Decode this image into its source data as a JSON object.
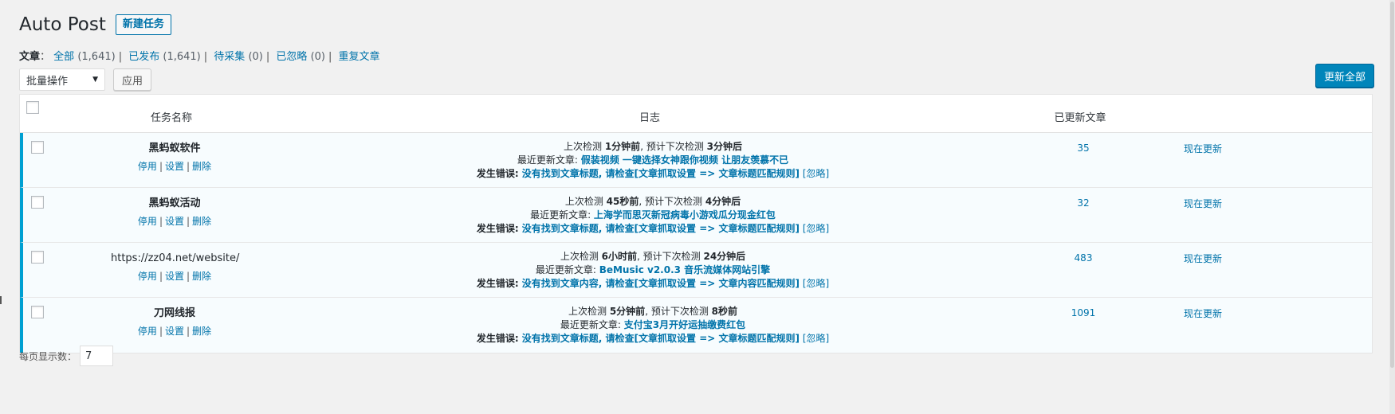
{
  "header": {
    "title": "Auto Post",
    "add_new": "新建任务"
  },
  "views": {
    "label": "文章",
    "colon": "：",
    "items": [
      {
        "label": "全部",
        "count": "(1,641)"
      },
      {
        "label": "已发布",
        "count": "(1,641)"
      },
      {
        "label": "待采集",
        "count": "(0)"
      },
      {
        "label": "已忽略",
        "count": "(0)"
      },
      {
        "label": "重复文章",
        "count": ""
      }
    ]
  },
  "tablenav": {
    "bulk_actions": "批量操作",
    "apply": "应用",
    "update_all": "更新全部"
  },
  "columns": {
    "name": "任务名称",
    "log": "日志",
    "updated": "已更新文章"
  },
  "row_actions": {
    "disable": "停用",
    "settings": "设置",
    "delete": "删除",
    "update_now": "现在更新"
  },
  "rows": [
    {
      "name": "黑蚂蚁软件",
      "last_check_prefix": "上次检测 ",
      "last_check": "1分钟前",
      "next_check_prefix": ", 预计下次检测 ",
      "next_check": "3分钟后",
      "latest_prefix": "最近更新文章: ",
      "latest": "假装视频 一键选择女神跟你视频 让朋友羡慕不已",
      "error_prefix": "发生错误:",
      "error": " 没有找到文章标题, 请检查[文章抓取设置 => 文章标题匹配规则]",
      "ignore": "[忽略]",
      "count": "35"
    },
    {
      "name": "黑蚂蚁活动",
      "last_check_prefix": "上次检测 ",
      "last_check": "45秒前",
      "next_check_prefix": ", 预计下次检测 ",
      "next_check": "4分钟后",
      "latest_prefix": "最近更新文章: ",
      "latest": "上海学而思灭新冠病毒小游戏瓜分现金红包",
      "error_prefix": "发生错误:",
      "error": " 没有找到文章标题, 请检查[文章抓取设置 => 文章标题匹配规则]",
      "ignore": "[忽略]",
      "count": "32"
    },
    {
      "name": "https://zz04.net/website/",
      "last_check_prefix": "上次检测 ",
      "last_check": "6小时前",
      "next_check_prefix": ", 预计下次检测 ",
      "next_check": "24分钟后",
      "latest_prefix": "最近更新文章: ",
      "latest": "BeMusic v2.0.3 音乐流媒体网站引擎",
      "error_prefix": "发生错误:",
      "error": " 没有找到文章内容, 请检查[文章抓取设置 => 文章内容匹配规则]",
      "ignore": "[忽略]",
      "count": "483"
    },
    {
      "name": "刀网线报",
      "last_check_prefix": "上次检测 ",
      "last_check": "5分钟前",
      "next_check_prefix": ", 预计下次检测 ",
      "next_check": "8秒前",
      "latest_prefix": "最近更新文章: ",
      "latest": "支付宝3月开好运抽缴费红包",
      "error_prefix": "发生错误:",
      "error": " 没有找到文章标题, 请检查[文章抓取设置 => 文章标题匹配规则]",
      "ignore": "[忽略]",
      "count": "1091"
    }
  ],
  "footer": {
    "per_page_label": "每页显示数：",
    "per_page_value": "7"
  },
  "colors": {
    "link": "#0073aa",
    "primary_button": "#0085ba",
    "row_accent": "#00a0d2",
    "row_bg": "#f7fcfe",
    "page_bg": "#f1f1f1"
  },
  "icons": {
    "select_arrow": "▼"
  }
}
